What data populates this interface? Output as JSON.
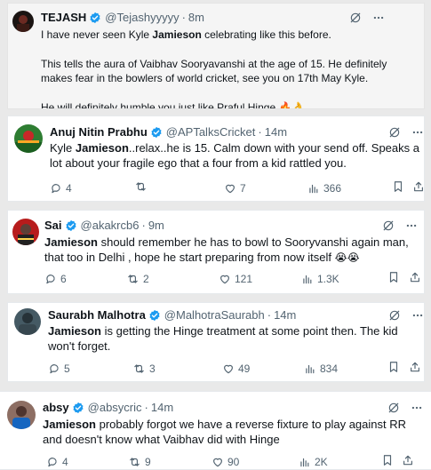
{
  "posts": [
    {
      "name": "TEJASH",
      "handle": "@Tejashyyyyy",
      "time": "8m",
      "paragraphs": [
        [
          {
            "t": "I have never seen Kyle "
          },
          {
            "t": "Jamieson",
            "b": true
          },
          {
            "t": " celebrating like this before."
          }
        ],
        [
          {
            "t": "This tells the aura of Vaibhav Sooryavanshi at the age of 15. He definitely makes fear in the bowlers of world cricket, see you on 17th May Kyle."
          }
        ],
        [
          {
            "t": "He will definitely humble you just like Praful Hinge "
          },
          {
            "t": "🔥👌",
            "e": true
          }
        ]
      ]
    },
    {
      "name": "Anuj Nitin Prabhu",
      "handle": "@APTalksCricket",
      "time": "14m",
      "paragraphs": [
        [
          {
            "t": "Kyle "
          },
          {
            "t": "Jamieson",
            "b": true
          },
          {
            "t": "..relax..he is 15. Calm down with your send off. Speaks a lot about your fragile ego that a four from a kid rattled you."
          }
        ]
      ],
      "stats": {
        "replies": "4",
        "reposts": "",
        "likes": "7",
        "views": "366"
      }
    },
    {
      "name": "Sai",
      "handle": "@akakrcb6",
      "time": "9m",
      "paragraphs": [
        [
          {
            "t": "Jamieson",
            "b": true
          },
          {
            "t": " should remember he has to bowl to Sooryvanshi again man, that too in Delhi , hope he start preparing from now itself "
          },
          {
            "t": "😭😭",
            "e": true
          }
        ]
      ],
      "stats": {
        "replies": "6",
        "reposts": "2",
        "likes": "121",
        "views": "1.3K"
      }
    },
    {
      "name": "Saurabh Malhotra",
      "handle": "@MalhotraSaurabh",
      "time": "14m",
      "paragraphs": [
        [
          {
            "t": "Jamieson",
            "b": true
          },
          {
            "t": " is getting the Hinge treatment at some point then. The kid won't forget."
          }
        ]
      ],
      "stats": {
        "replies": "5",
        "reposts": "3",
        "likes": "49",
        "views": "834"
      }
    },
    {
      "name": "absy",
      "handle": "@absycric",
      "time": "14m",
      "paragraphs": [
        [
          {
            "t": "Jamieson",
            "b": true
          },
          {
            "t": " probably forgot we have a reverse fixture to play against RR and doesn't know what Vaibhav did with Hinge"
          }
        ]
      ],
      "stats": {
        "replies": "4",
        "reposts": "9",
        "likes": "90",
        "views": "2K"
      }
    }
  ],
  "colors": {
    "text": "#0f1419",
    "muted": "#536471",
    "verified": "#1d9bf0",
    "card_bg": "#ffffff",
    "first_card_bg": "#f5f5f5",
    "page_bg": "#e9e9e9"
  },
  "icons": {
    "verified": "verified-badge-icon",
    "grok": "grok-icon",
    "more": "more-dots-icon",
    "reply": "reply-icon",
    "repost": "repost-icon",
    "like": "heart-icon",
    "views": "views-icon",
    "bookmark": "bookmark-icon",
    "share": "share-icon"
  }
}
